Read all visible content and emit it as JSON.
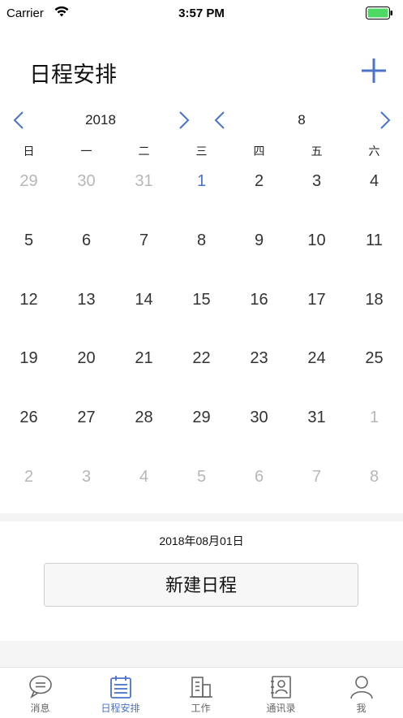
{
  "status_bar": {
    "carrier": "Carrier",
    "time": "3:57 PM"
  },
  "header": {
    "title": "日程安排"
  },
  "nav": {
    "year": "2018",
    "month": "8"
  },
  "weekdays": [
    "日",
    "一",
    "二",
    "三",
    "四",
    "五",
    "六"
  ],
  "days": [
    [
      {
        "t": "29",
        "s": "other"
      },
      {
        "t": "30",
        "s": "other"
      },
      {
        "t": "31",
        "s": "other"
      },
      {
        "t": "1",
        "s": "selected"
      },
      {
        "t": "2",
        "s": "current"
      },
      {
        "t": "3",
        "s": "current"
      },
      {
        "t": "4",
        "s": "current"
      }
    ],
    [
      {
        "t": "5",
        "s": "current"
      },
      {
        "t": "6",
        "s": "current"
      },
      {
        "t": "7",
        "s": "current"
      },
      {
        "t": "8",
        "s": "current"
      },
      {
        "t": "9",
        "s": "current"
      },
      {
        "t": "10",
        "s": "current"
      },
      {
        "t": "11",
        "s": "current"
      }
    ],
    [
      {
        "t": "12",
        "s": "current"
      },
      {
        "t": "13",
        "s": "current"
      },
      {
        "t": "14",
        "s": "current"
      },
      {
        "t": "15",
        "s": "current"
      },
      {
        "t": "16",
        "s": "current"
      },
      {
        "t": "17",
        "s": "current"
      },
      {
        "t": "18",
        "s": "current"
      }
    ],
    [
      {
        "t": "19",
        "s": "current"
      },
      {
        "t": "20",
        "s": "current"
      },
      {
        "t": "21",
        "s": "current"
      },
      {
        "t": "22",
        "s": "current"
      },
      {
        "t": "23",
        "s": "current"
      },
      {
        "t": "24",
        "s": "current"
      },
      {
        "t": "25",
        "s": "current"
      }
    ],
    [
      {
        "t": "26",
        "s": "current"
      },
      {
        "t": "27",
        "s": "current"
      },
      {
        "t": "28",
        "s": "current"
      },
      {
        "t": "29",
        "s": "current"
      },
      {
        "t": "30",
        "s": "current"
      },
      {
        "t": "31",
        "s": "current"
      },
      {
        "t": "1",
        "s": "other"
      }
    ],
    [
      {
        "t": "2",
        "s": "other"
      },
      {
        "t": "3",
        "s": "other"
      },
      {
        "t": "4",
        "s": "other"
      },
      {
        "t": "5",
        "s": "other"
      },
      {
        "t": "6",
        "s": "other"
      },
      {
        "t": "7",
        "s": "other"
      },
      {
        "t": "8",
        "s": "other"
      }
    ]
  ],
  "selected_date": "2018年08月01日",
  "new_schedule_label": "新建日程",
  "tabs": [
    {
      "label": "消息",
      "icon": "chat-icon"
    },
    {
      "label": "日程安排",
      "icon": "calendar-icon"
    },
    {
      "label": "工作",
      "icon": "building-icon"
    },
    {
      "label": "通讯录",
      "icon": "contacts-icon"
    },
    {
      "label": "我",
      "icon": "person-icon"
    }
  ],
  "active_tab": 1,
  "colors": {
    "accent": "#4a73c9",
    "muted_day": "#b7b7b7",
    "battery": "#4cd964"
  }
}
